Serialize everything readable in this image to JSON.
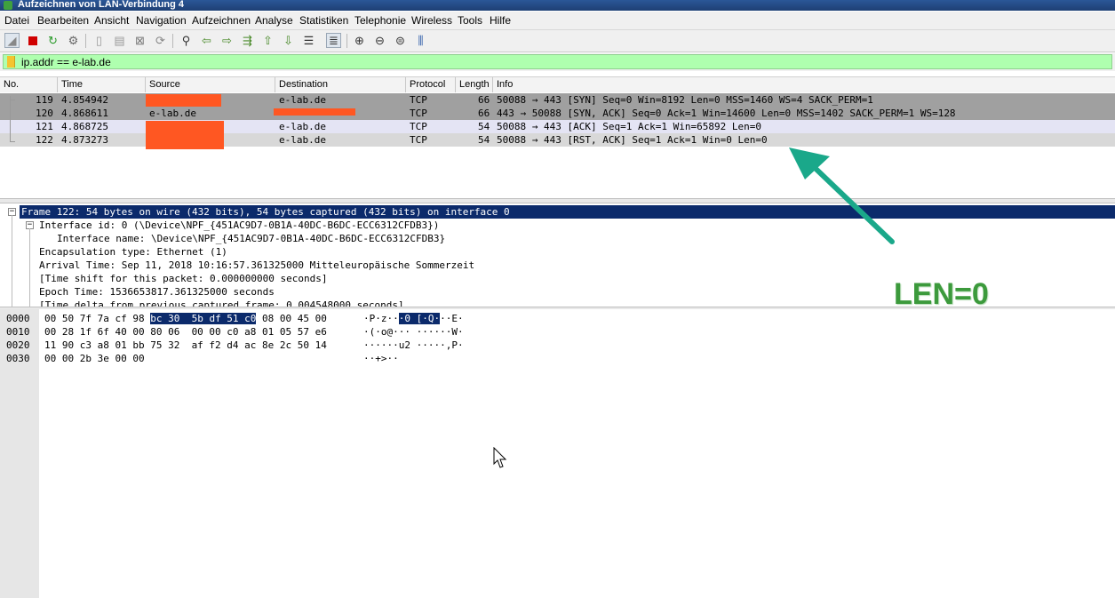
{
  "window": {
    "title": "Aufzeichnen von LAN-Verbindung 4"
  },
  "menu": [
    "Datei",
    "Bearbeiten",
    "Ansicht",
    "Navigation",
    "Aufzeichnen",
    "Analyse",
    "Statistiken",
    "Telephonie",
    "Wireless",
    "Tools",
    "Hilfe"
  ],
  "toolbar": {
    "icons": [
      "shark-fin-start-icon",
      "stop-icon",
      "restart-icon",
      "options-gear-icon",
      "open-file-icon",
      "save-file-icon",
      "close-file-icon",
      "reload-icon",
      "find-icon",
      "go-back-icon",
      "go-forward-icon",
      "go-to-packet-icon",
      "first-packet-icon",
      "last-packet-icon",
      "autoscroll-icon",
      "colorize-icon",
      "zoom-in-icon",
      "zoom-out-icon",
      "zoom-normal-icon",
      "resize-columns-icon"
    ]
  },
  "filter": {
    "value": "ip.addr == e-lab.de"
  },
  "packet_list": {
    "columns": [
      "No.",
      "Time",
      "Source",
      "Destination",
      "Protocol",
      "Length",
      "Info"
    ],
    "rows": [
      {
        "no": "119",
        "time": "4.854942",
        "source": "",
        "destination": "e-lab.de",
        "protocol": "TCP",
        "length": "66",
        "info": "50088 → 443 [SYN] Seq=0 Win=8192 Len=0 MSS=1460 WS=4 SACK_PERM=1"
      },
      {
        "no": "120",
        "time": "4.868611",
        "source": "e-lab.de",
        "destination": "",
        "protocol": "TCP",
        "length": "66",
        "info": "443 → 50088 [SYN, ACK] Seq=0 Ack=1 Win=14600 Len=0 MSS=1402 SACK_PERM=1 WS=128"
      },
      {
        "no": "121",
        "time": "4.868725",
        "source": "",
        "destination": "e-lab.de",
        "protocol": "TCP",
        "length": "54",
        "info": "50088 → 443 [ACK] Seq=1 Ack=1 Win=65892 Len=0"
      },
      {
        "no": "122",
        "time": "4.873273",
        "source": "",
        "destination": "e-lab.de",
        "protocol": "TCP",
        "length": "54",
        "info": "50088 → 443 [RST, ACK] Seq=1 Ack=1 Win=0 Len=0"
      }
    ]
  },
  "details": [
    "Frame 122: 54 bytes on wire (432 bits), 54 bytes captured (432 bits) on interface 0",
    "Interface id: 0 (\\Device\\NPF_{451AC9D7-0B1A-40DC-B6DC-ECC6312CFDB3})",
    "Interface name: \\Device\\NPF_{451AC9D7-0B1A-40DC-B6DC-ECC6312CFDB3}",
    "Encapsulation type: Ethernet (1)",
    "Arrival Time: Sep 11, 2018 10:16:57.361325000 Mitteleuropäische Sommerzeit",
    "[Time shift for this packet: 0.000000000 seconds]",
    "Epoch Time: 1536653817.361325000 seconds",
    "[Time delta from previous captured frame: 0.004548000 seconds]"
  ],
  "bytes": {
    "offsets": [
      "0000",
      "0010",
      "0020",
      "0030"
    ],
    "line0": {
      "pre": "00 50 7f 7a cf 98 ",
      "hl": "bc 30  5b df 51 c0",
      "post": " 08 00 45 00",
      "ascii_pre": "·P·z··",
      "ascii_hl": "·0 [·Q·",
      "ascii_post": "··E·"
    },
    "hex": [
      "00 28 1f 6f 40 00 80 06  00 00 c0 a8 01 05 57 e6",
      "11 90 c3 a8 01 bb 75 32  af f2 d4 ac 8e 2c 50 14",
      "00 00 2b 3e 00 00"
    ],
    "ascii": [
      "·(·o@··· ······W·",
      "······u2 ·····,P·",
      "··+>··"
    ]
  },
  "annotation": {
    "text": "LEN=0",
    "color": "#3c9a3c",
    "arrow_color": "#1aa88a"
  },
  "redaction_color": "#ff5722",
  "colors": {
    "tcp_row": "#a0a0a0",
    "selected_row": "#e4e4f4",
    "filter_ok": "#afffaf",
    "detail_selected": "#0b2a6b"
  }
}
